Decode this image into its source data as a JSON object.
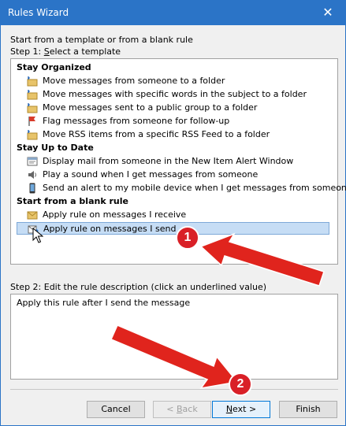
{
  "window": {
    "title": "Rules Wizard",
    "close_glyph": "✕"
  },
  "intro_text": "Start from a template or from a blank rule",
  "step1": {
    "prefix": "Step 1: ",
    "underlined": "S",
    "rest": "elect a template"
  },
  "groups": [
    {
      "header": "Stay Organized",
      "items": [
        {
          "icon": "move-folder-icon",
          "label": "Move messages from someone to a folder"
        },
        {
          "icon": "move-folder-icon",
          "label": "Move messages with specific words in the subject to a folder"
        },
        {
          "icon": "move-folder-icon",
          "label": "Move messages sent to a public group to a folder"
        },
        {
          "icon": "flag-icon",
          "label": "Flag messages from someone for follow-up"
        },
        {
          "icon": "move-folder-icon",
          "label": "Move RSS items from a specific RSS Feed to a folder"
        }
      ]
    },
    {
      "header": "Stay Up to Date",
      "items": [
        {
          "icon": "alert-window-icon",
          "label": "Display mail from someone in the New Item Alert Window"
        },
        {
          "icon": "speaker-icon",
          "label": "Play a sound when I get messages from someone"
        },
        {
          "icon": "mobile-phone-icon",
          "label": "Send an alert to my mobile device when I get messages from someone"
        }
      ]
    },
    {
      "header": "Start from a blank rule",
      "items": [
        {
          "icon": "envelope-icon",
          "label": "Apply rule on messages I receive"
        },
        {
          "icon": "send-icon",
          "label": "Apply rule on messages I send",
          "selected": true
        }
      ]
    }
  ],
  "step2": {
    "label": "Step 2: Edit the rule description (click an underlined value)"
  },
  "description": "Apply this rule after I send the message",
  "buttons": {
    "cancel": "Cancel",
    "back_pre": "< ",
    "back_u": "B",
    "back_post": "ack",
    "next_u": "N",
    "next_post": "ext >",
    "finish": "Finish"
  },
  "annotations": {
    "badge1": "1",
    "badge2": "2"
  },
  "colors": {
    "titlebar": "#2b74c7",
    "selection": "#c6ddf5",
    "arrow_red": "#e0241d"
  }
}
